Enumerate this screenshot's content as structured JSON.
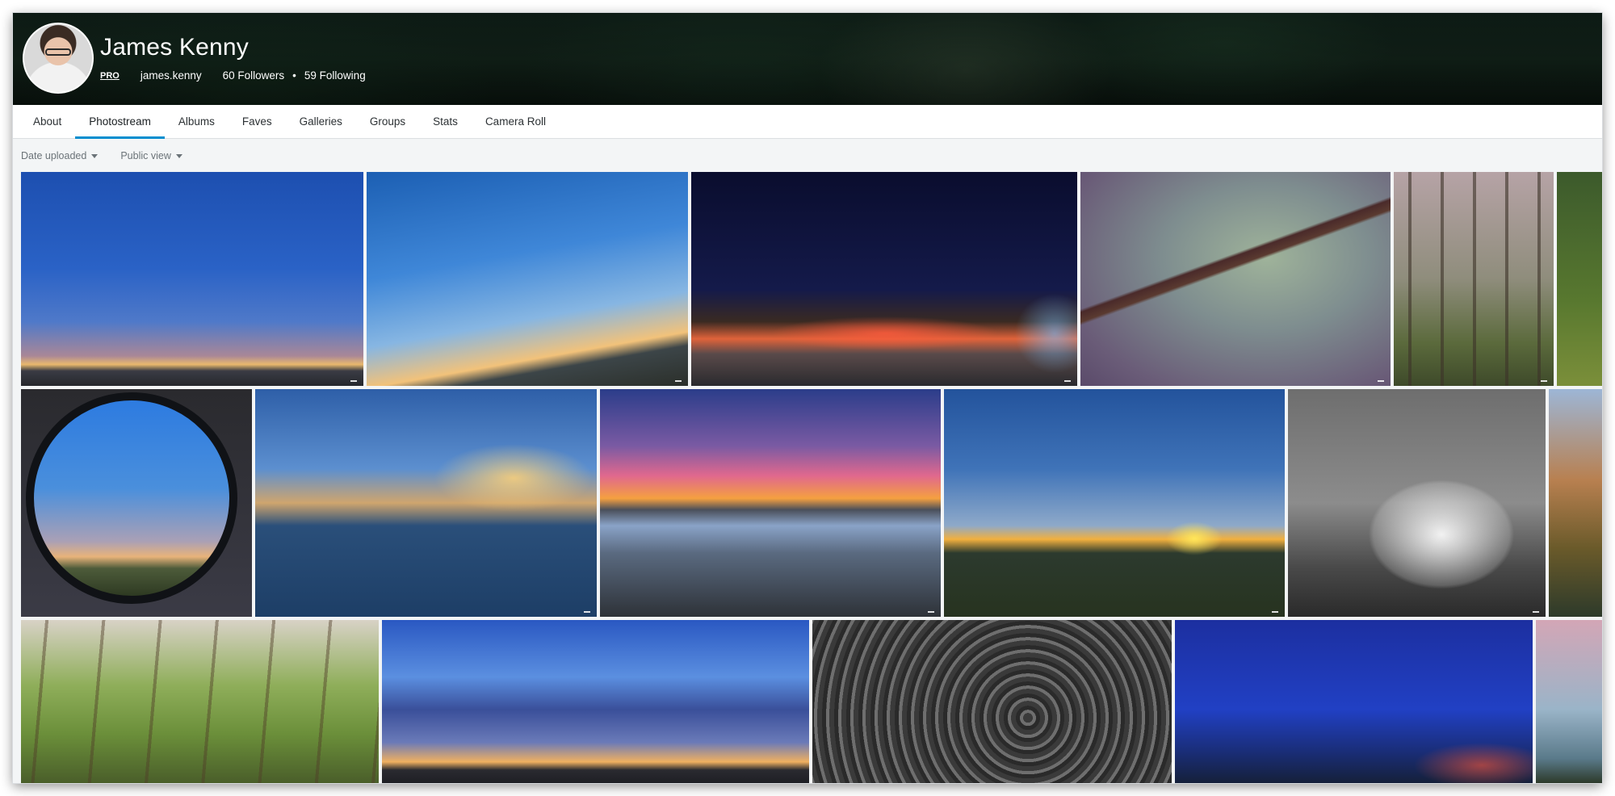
{
  "profile": {
    "name": "James Kenny",
    "badge": "PRO",
    "username": "james.kenny",
    "followers": "60 Followers",
    "separator": "•",
    "following": "59 Following"
  },
  "nav": {
    "tabs": [
      {
        "label": "About"
      },
      {
        "label": "Photostream",
        "active": true
      },
      {
        "label": "Albums"
      },
      {
        "label": "Faves"
      },
      {
        "label": "Galleries"
      },
      {
        "label": "Groups"
      },
      {
        "label": "Stats"
      },
      {
        "label": "Camera Roll"
      }
    ]
  },
  "filters": {
    "sort": {
      "label": "Date uploaded",
      "icon": "caret-down-icon"
    },
    "view": {
      "label": "Public view",
      "icon": "caret-down-icon"
    }
  },
  "colors": {
    "accent": "#008ecf",
    "nav_text": "#2c3134",
    "filter_text": "#6b7378",
    "background": "#f3f5f6"
  }
}
